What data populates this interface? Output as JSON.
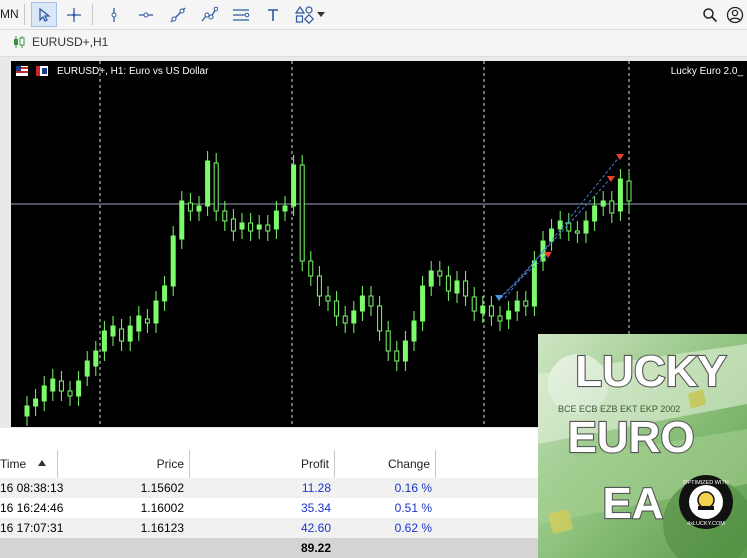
{
  "toolbar": {
    "left_label": "MN",
    "tools": [
      "cursor-tool",
      "crosshair-tool",
      "vertical-line-tool",
      "horizontal-line-tool",
      "trend-line-tool",
      "multi-point-tool",
      "channel-tool",
      "text-tool",
      "shapes-tool"
    ]
  },
  "tab": {
    "label": "EURUSD+,H1"
  },
  "chart": {
    "title": "EURUSD+, H1:  Euro vs US Dollar",
    "ea_label": "Lucky Euro 2.0_",
    "colors": {
      "background": "#000000",
      "candle": "#7CFC6A",
      "grid": "#ffffff",
      "marker_sell": "#e8412c",
      "marker_buy": "#3f9de0"
    }
  },
  "table": {
    "headers": {
      "time": "Time",
      "price": "Price",
      "profit": "Profit",
      "change": "Change"
    },
    "rows": [
      {
        "time": "16 08:38:13",
        "price": "1.15602",
        "profit": "11.28",
        "change": "0.16 %"
      },
      {
        "time": "16 16:24:46",
        "price": "1.16002",
        "profit": "35.34",
        "change": "0.51 %"
      },
      {
        "time": "16 17:07:31",
        "price": "1.16123",
        "profit": "42.60",
        "change": "0.62 %"
      }
    ],
    "total": "89.22"
  },
  "banner": {
    "line1": "LUCKY",
    "line2": "EURO",
    "line3": "EA",
    "badge_top": "OPTIMIZED WITH",
    "badge_bottom": "4xLUCKY.COM",
    "note_text": "BCE ECB EZB EKT EKP 2002"
  }
}
